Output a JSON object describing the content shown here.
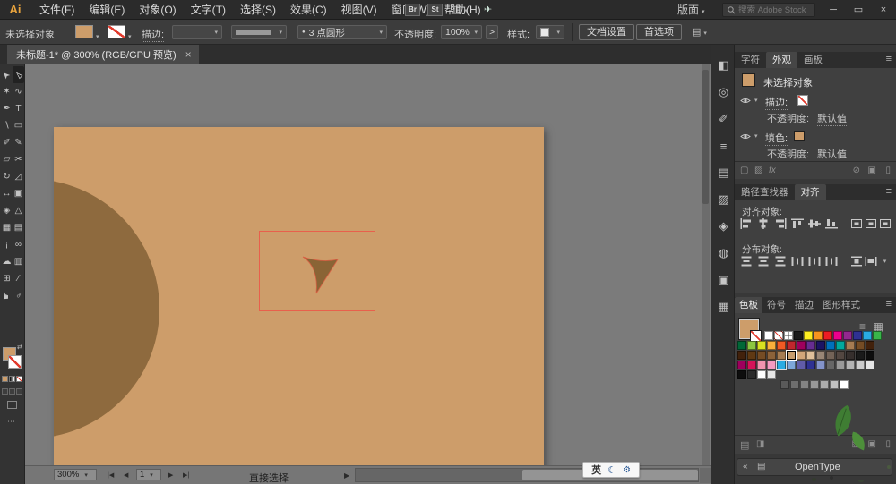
{
  "menubar": {
    "logo": "Ai",
    "items": [
      "文件(F)",
      "编辑(E)",
      "对象(O)",
      "文字(T)",
      "选择(S)",
      "效果(C)",
      "视图(V)",
      "窗口(W)",
      "帮助(H)"
    ],
    "bridge": "Br",
    "stock": "St",
    "workspace": "版面",
    "search_placeholder": "搜索 Adobe Stock",
    "window_buttons": {
      "minimize": "─",
      "maximize": "▭",
      "close": "×"
    }
  },
  "controlbar": {
    "no_selection": "未选择对象",
    "stroke_label": "描边:",
    "brush_name": "3 点圆形",
    "opacity_label": "不透明度:",
    "opacity_value": "100%",
    "opacity_more": ">",
    "style_label": "样式:",
    "doc_setup": "文档设置",
    "preferences": "首选项"
  },
  "tabbar": {
    "title": "未标题-1* @ 300% (RGB/GPU 预览)",
    "close": "×"
  },
  "toolbar": {
    "tools": [
      {
        "name": "selection-tool",
        "glyph": "➤",
        "rot": -135
      },
      {
        "name": "direct-selection-tool",
        "glyph": "▻",
        "rot": -135,
        "active": true
      },
      {
        "name": "magic-wand-tool",
        "glyph": "✶"
      },
      {
        "name": "lasso-tool",
        "glyph": "∿"
      },
      {
        "name": "pen-tool",
        "glyph": "✒"
      },
      {
        "name": "type-tool",
        "glyph": "T"
      },
      {
        "name": "line-segment-tool",
        "glyph": "∖"
      },
      {
        "name": "rectangle-tool",
        "glyph": "▭"
      },
      {
        "name": "paintbrush-tool",
        "glyph": "✐"
      },
      {
        "name": "pencil-tool",
        "glyph": "✎"
      },
      {
        "name": "eraser-tool",
        "glyph": "▱"
      },
      {
        "name": "scissors-tool",
        "glyph": "✂"
      },
      {
        "name": "rotate-tool",
        "glyph": "↻"
      },
      {
        "name": "scale-tool",
        "glyph": "◿"
      },
      {
        "name": "width-tool",
        "glyph": "↔"
      },
      {
        "name": "free-transform-tool",
        "glyph": "▣"
      },
      {
        "name": "shape-builder-tool",
        "glyph": "◈"
      },
      {
        "name": "perspective-grid-tool",
        "glyph": "△"
      },
      {
        "name": "mesh-tool",
        "glyph": "▦"
      },
      {
        "name": "gradient-tool",
        "glyph": "▤"
      },
      {
        "name": "eyedropper-tool",
        "glyph": "¡"
      },
      {
        "name": "blend-tool",
        "glyph": "∞"
      },
      {
        "name": "symbol-sprayer-tool",
        "glyph": "☁"
      },
      {
        "name": "column-graph-tool",
        "glyph": "▥"
      },
      {
        "name": "artboard-tool",
        "glyph": "⊞"
      },
      {
        "name": "slice-tool",
        "glyph": "∕"
      },
      {
        "name": "hand-tool",
        "glyph": "☛",
        "rot": -90
      },
      {
        "name": "zoom-tool",
        "glyph": "♁",
        "rot": 45
      }
    ]
  },
  "canvas": {
    "pasteboard": "#7b7b7b",
    "artboard_color": "#cd9d6a",
    "circle_color": "#8e6a3e",
    "shape_color": "#8a6435",
    "selection_color": "#e8604c"
  },
  "statusbar": {
    "zoom": "300%",
    "first": "|◀",
    "prev": "◀",
    "artboard_number": "1",
    "next": "▶",
    "last": "▶|",
    "tool_name": "直接选择",
    "marker": "▶"
  },
  "ime": {
    "lang": "英",
    "moon": "☾",
    "gear": "⚙"
  },
  "panel_strip": {
    "icons": [
      {
        "name": "color-panel-icon",
        "glyph": "◧"
      },
      {
        "name": "color-guide-panel-icon",
        "glyph": "◎"
      },
      {
        "name": "brushes-panel-icon",
        "glyph": "✐"
      },
      {
        "name": "stroke-panel-icon",
        "glyph": "≡"
      },
      {
        "name": "gradient-panel-icon",
        "glyph": "▤"
      },
      {
        "name": "transparency-panel-icon",
        "glyph": "▨"
      },
      {
        "name": "graphic-styles-panel-icon",
        "glyph": "◈"
      },
      {
        "name": "symbols-panel-icon",
        "glyph": "◍"
      },
      {
        "name": "layers-panel-icon",
        "glyph": "▣"
      },
      {
        "name": "libraries-panel-icon",
        "glyph": "▦"
      }
    ]
  },
  "panels": {
    "appearance": {
      "tabs": [
        "字符",
        "外观",
        "画板"
      ],
      "no_selection": "未选择对象",
      "stroke_label": "描边:",
      "fill_label": "填色:",
      "opacity_label": "不透明度:",
      "opacity_value": "默认值",
      "fx": "fx"
    },
    "align": {
      "tab_pathfinder": "路径查找器",
      "tab_align": "对齐",
      "align_objects_label": "对齐对象:",
      "distribute_objects_label": "分布对象:",
      "align_icons": [
        {
          "name": "align-left-icon",
          "k": "h-left"
        },
        {
          "name": "align-h-center-icon",
          "k": "h-center"
        },
        {
          "name": "align-right-icon",
          "k": "h-right"
        },
        {
          "name": "align-top-icon",
          "k": "v-top"
        },
        {
          "name": "align-v-center-icon",
          "k": "v-center"
        },
        {
          "name": "align-bottom-icon",
          "k": "v-bottom"
        }
      ],
      "align_extra": [
        {
          "name": "align-to-selection-icon",
          "k": "art"
        },
        {
          "name": "align-to-key-object-icon",
          "k": "art"
        },
        {
          "name": "align-to-artboard-icon",
          "k": "art"
        }
      ],
      "distribute_icons": [
        {
          "name": "distribute-top-icon",
          "k": "d-v"
        },
        {
          "name": "distribute-v-center-icon",
          "k": "d-v"
        },
        {
          "name": "distribute-bottom-icon",
          "k": "d-v"
        },
        {
          "name": "distribute-left-icon",
          "k": "d-h"
        },
        {
          "name": "distribute-h-center-icon",
          "k": "d-h"
        },
        {
          "name": "distribute-right-icon",
          "k": "d-h"
        }
      ],
      "distribute_extra": [
        {
          "name": "distribute-spacing-v-icon",
          "k": "sp-v"
        },
        {
          "name": "distribute-spacing-h-icon",
          "k": "sp-h"
        },
        {
          "name": "align-options-caret",
          "k": "caret"
        }
      ]
    },
    "swatches": {
      "tabs": [
        "色板",
        "符号",
        "描边",
        "图形样式"
      ],
      "rows": [
        {
          "offset": 30,
          "colors": [
            "#ffffff",
            "none",
            "reg",
            "#1a1a1a",
            "#fcee21",
            "#f7931e",
            "#ed1c24",
            "#ec008c",
            "#93278f",
            "#2e3192",
            "#29abe2",
            "#39b54a"
          ]
        },
        {
          "offset": 0,
          "colors": [
            "#006837",
            "#8cc63f",
            "#d9e021",
            "#fbb03b",
            "#f15a24",
            "#c1272d",
            "#9e005d",
            "#662d91",
            "#1b1464",
            "#0071bc",
            "#00a99d",
            "#a67c52",
            "#754c24",
            "#42210b"
          ]
        },
        {
          "offset": 0,
          "colors": [
            "#42210b",
            "#603913",
            "#754c24",
            "#8c6239",
            "#a67c52",
            "#c69c6d",
            "#d2a679",
            "#e0c09a",
            "#998675",
            "#736357",
            "#534741",
            "#362f2d",
            "#1a1a1a",
            "#0d0d0d"
          ]
        },
        {
          "offset": 0,
          "colors": [
            "#9e005d",
            "#d4145a",
            "#f093b0",
            "#f49ac1",
            "#29abe2",
            "#7da7d9",
            "#605ca8",
            "#2e3192",
            "#8393ca",
            "#666666",
            "#999999",
            "#b3b3b3",
            "#cccccc",
            "#e6e6e6"
          ]
        },
        {
          "offset": 0,
          "colors": [
            "#0d0d0d",
            "#2b2b2b",
            "#ffffff",
            "#e6e6e6"
          ]
        },
        {
          "offset": 48,
          "colors": [
            "#595959",
            "#6e6e6e",
            "#838383",
            "#989898",
            "#adadad",
            "#c2c2c2",
            "#ffffff"
          ]
        }
      ],
      "selected_pos": [
        2,
        5
      ],
      "highlight_pos": [
        3,
        4
      ]
    },
    "opentype": {
      "title": "OpenType"
    }
  }
}
